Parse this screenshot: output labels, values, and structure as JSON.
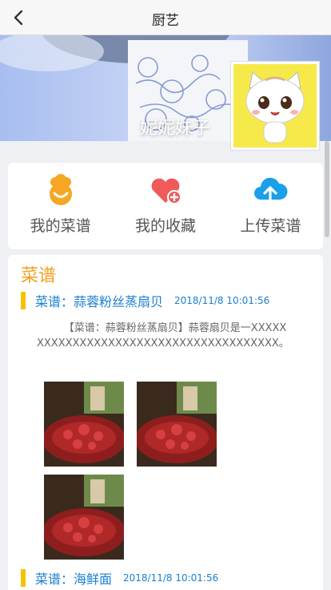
{
  "header": {
    "title": "厨艺",
    "back_icon": "chevron-left-icon"
  },
  "profile": {
    "nickname": "妮妮妹子",
    "avatar_icon": "cartoon-cat-avatar"
  },
  "actions": [
    {
      "label": "我的菜谱",
      "icon": "chef-hat-icon",
      "color": "#f5a623"
    },
    {
      "label": "我的收藏",
      "icon": "heart-plus-icon",
      "color": "#ef5a5a"
    },
    {
      "label": "上传菜谱",
      "icon": "cloud-upload-icon",
      "color": "#1aa0e8"
    }
  ],
  "recipes": {
    "heading": "菜谱",
    "items": [
      {
        "title": "菜谱：蒜蓉粉丝蒸扇贝",
        "time": "2018/11/8 10:01:56",
        "description": "【菜谱：蒜蓉粉丝蒸扇贝】蒜蓉扇贝是一XXXXXXXXXXXXXXXXXXXXXXXXXXXXXXXXXXXXXXX。",
        "images": [
          "crayfish-dish-photo",
          "crayfish-dish-photo",
          "crayfish-dish-photo"
        ]
      },
      {
        "title": "菜谱：海鲜面",
        "time": "2018/11/8 10:01:56"
      }
    ]
  },
  "colors": {
    "accent": "#f0a020",
    "link": "#1a7fd0",
    "marker": "#f5c200"
  }
}
